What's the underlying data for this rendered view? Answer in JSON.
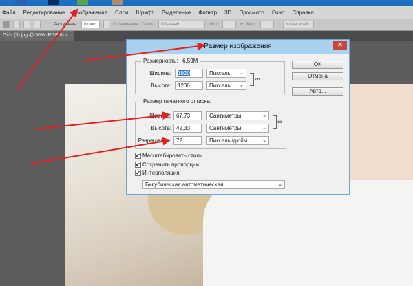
{
  "menu": [
    "Файл",
    "Редактирование",
    "Изображение",
    "Слои",
    "Шрифт",
    "Выделение",
    "Фильтр",
    "3D",
    "Просмотр",
    "Окно",
    "Справка"
  ],
  "options": {
    "feather_label": "Растушевка:",
    "feather_value": "0 пикс.",
    "antialias": "Сглаживание",
    "style_label": "Стиль:",
    "style_value": "Обычный",
    "width_label": "Шир.:",
    "height_label": "Выс.:",
    "refine": "Уточн. край..."
  },
  "document_tab": {
    "title": "Girls (3).jpg @ 50% (RGB/8)",
    "close": "×"
  },
  "dialog": {
    "title": "Размер изображения",
    "close": "✕",
    "pixel_dims": {
      "label": "Размерность:",
      "value": "6,59M",
      "width_label": "Ширина:",
      "width_value": "1920",
      "width_unit": "Пикселы",
      "height_label": "Высота:",
      "height_value": "1200",
      "height_unit": "Пикселы"
    },
    "print_size": {
      "label": "Размер печатного оттиска:",
      "width_label": "Ширина:",
      "width_value": "67,73",
      "width_unit": "Сантиметры",
      "height_label": "Высота:",
      "height_value": "42,33",
      "height_unit": "Сантиметры",
      "res_label": "Разрешение:",
      "res_value": "72",
      "res_unit": "Пикселы/дюйм"
    },
    "buttons": {
      "ok": "OK",
      "cancel": "Отмена",
      "auto": "Авто..."
    },
    "checks": {
      "scale_styles": "Масштабировать стили",
      "constrain": "Сохранить пропорции",
      "resample": "Интерполяция:"
    },
    "resample_method": "Бикубическая автоматическая"
  },
  "colors": {
    "arrow": "#e02020",
    "titlebar": "#a9d2ef"
  }
}
